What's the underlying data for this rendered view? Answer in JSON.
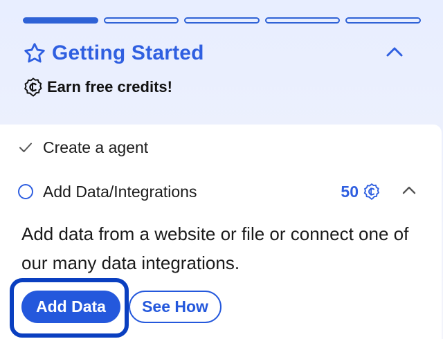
{
  "progress": {
    "total_steps": 5,
    "completed_steps": 1,
    "fill_color": "#2f62d6"
  },
  "header": {
    "icon": "star-outline-icon",
    "title": "Getting Started",
    "collapse_icon": "chevron-up-icon"
  },
  "credits": {
    "icon": "credit-coin-icon",
    "text": "Earn free credits!"
  },
  "steps": [
    {
      "label": "Create a agent",
      "status": "completed",
      "icon": "check-icon"
    },
    {
      "label": "Add Data/Integrations",
      "status": "pending",
      "icon": "radio-empty-icon",
      "reward": "50",
      "reward_icon": "credit-coin-icon",
      "expanded": true,
      "description": "Add data from a website or file or connect one of our many data integrations.",
      "primary_button": "Add Data",
      "secondary_button": "See How"
    }
  ],
  "colors": {
    "accent": "#2f5fe0",
    "primary_button": "#2458dc",
    "focus_ring": "#0a3fc0",
    "header_bg": "#e8eeff"
  }
}
